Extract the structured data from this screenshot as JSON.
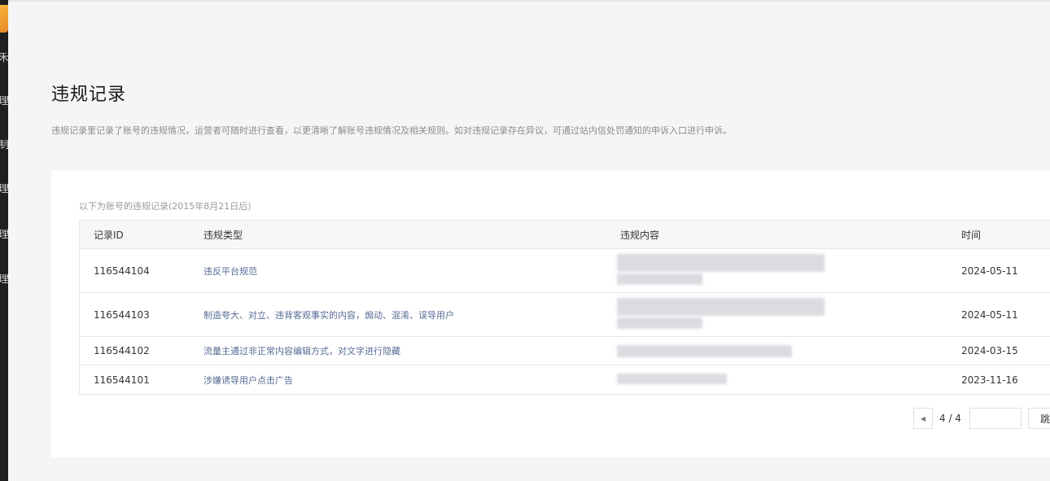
{
  "sidebar": {
    "fragments": [
      "禾",
      "理",
      "制",
      "理",
      "理",
      "理"
    ]
  },
  "header": {
    "title": "违规记录",
    "description": "违规记录里记录了账号的违规情况，运营者可随时进行查看，以更清晰了解账号违规情况及相关规则。如对违规记录存在异议，可通过站内信处罚通知的申诉入口进行申诉。"
  },
  "card": {
    "note": "以下为账号的违规记录(2015年8月21日后)",
    "columns": {
      "id": "记录ID",
      "type": "违规类型",
      "content": "违规内容",
      "time": "时间"
    },
    "rows": [
      {
        "id": "116544104",
        "type": "违反平台规范",
        "time": "2024-05-11"
      },
      {
        "id": "116544103",
        "type": "制造夸大、对立、违背客观事实的内容，煽动、混淆、误导用户",
        "time": "2024-05-11"
      },
      {
        "id": "116544102",
        "type": "流量主通过非正常内容编辑方式，对文字进行隐藏",
        "time": "2024-03-15"
      },
      {
        "id": "116544101",
        "type": "涉嫌诱导用户点击广告",
        "time": "2023-11-16"
      }
    ]
  },
  "pagination": {
    "prev_icon": "◀",
    "page_label": "4 / 4",
    "input_value": "",
    "jump_label": "跳转"
  }
}
